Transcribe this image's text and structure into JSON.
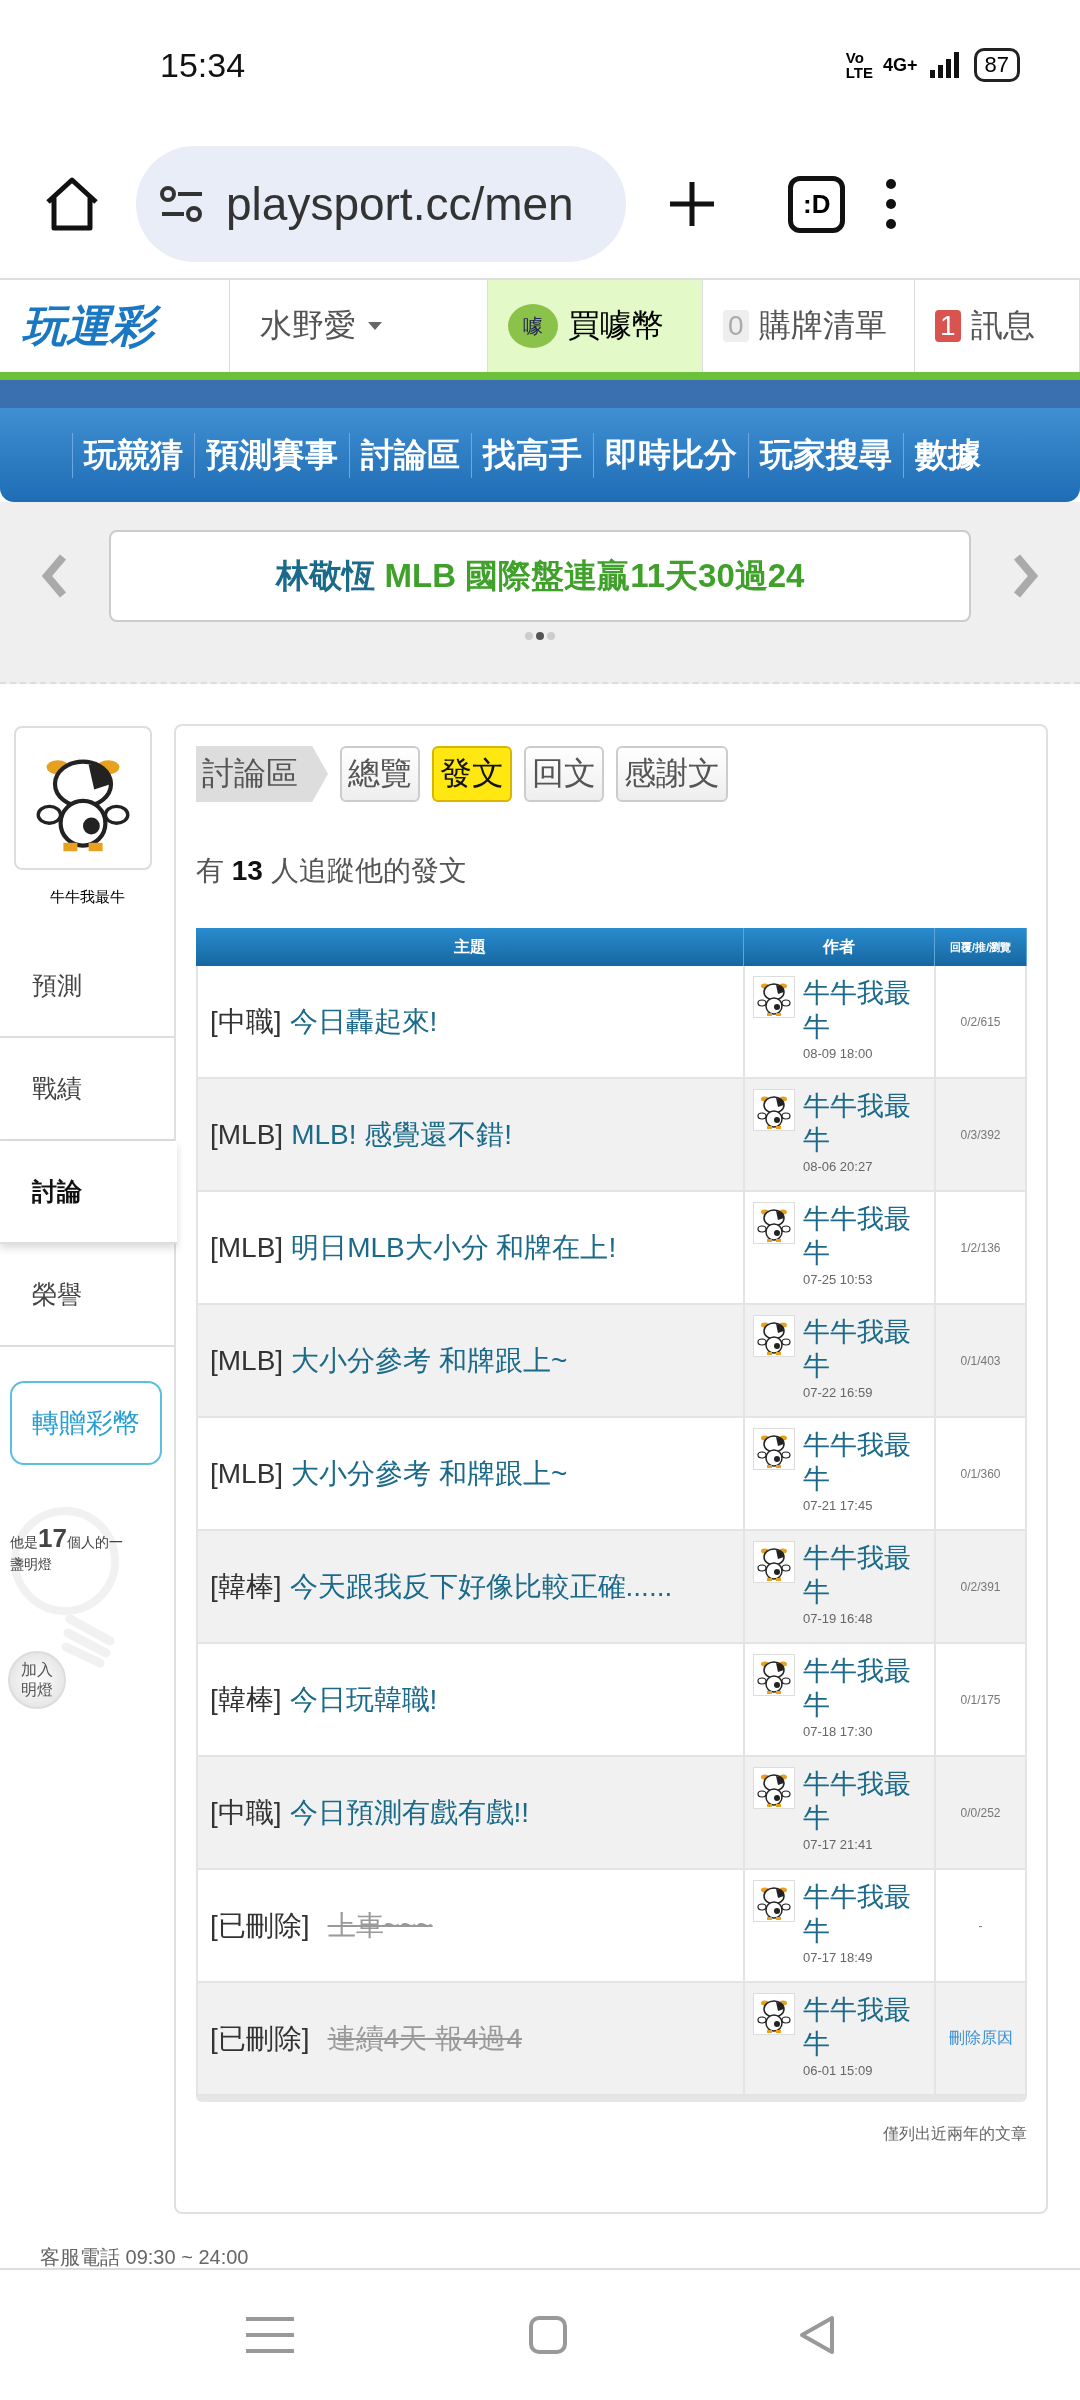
{
  "status_bar": {
    "time": "15:34",
    "volte": [
      "Vo",
      "LTE"
    ],
    "network": "4G+",
    "battery": "87"
  },
  "browser": {
    "url": "playsport.cc/men",
    "tabs_label": ":D"
  },
  "site_header": {
    "logo": "玩運彩",
    "user": "水野愛",
    "buy": {
      "coin_glyph": "噱",
      "label": "買噱幣"
    },
    "cart": {
      "count": "0",
      "label": "購牌清單"
    },
    "messages": {
      "count": "1",
      "label": "訊息"
    }
  },
  "nav": [
    "玩競猜",
    "預測賽事",
    "討論區",
    "找高手",
    "即時比分",
    "玩家搜尋",
    "數據"
  ],
  "banner": {
    "name": "林敬恆",
    "text": "MLB 國際盤連贏11天30過24",
    "dots": [
      {
        "selected": false
      },
      {
        "selected": true
      },
      {
        "selected": false
      }
    ]
  },
  "profile": {
    "name": "牛牛我最牛",
    "menu": [
      {
        "label": "預測",
        "selected": false
      },
      {
        "label": "戰績",
        "selected": false
      },
      {
        "label": "討論",
        "selected": true
      },
      {
        "label": "榮譽",
        "selected": false
      }
    ],
    "gift_button": "轉贈彩幣",
    "lamp_text": "他是**17**個人的一盞明燈",
    "lamp_button": "加入明燈"
  },
  "forum": {
    "section": "討論區",
    "tabs": [
      {
        "label": "總覽",
        "selected": false
      },
      {
        "label": "發文",
        "selected": true
      },
      {
        "label": "回文",
        "selected": false
      },
      {
        "label": "感謝文",
        "selected": false
      }
    ],
    "follow_text": "有 **13** 人追蹤他的發文",
    "table": {
      "columns": [
        "主題",
        "作者",
        "回覆/推/瀏覽"
      ],
      "rows": [
        {
          "kind": "post",
          "category": "[中職]",
          "title": "今日轟起來!",
          "author": "牛牛我最牛",
          "date": "08-09 18:00",
          "stats": {
            "kind": "text",
            "text": "0/2/615"
          }
        },
        {
          "kind": "post",
          "category": "[MLB]",
          "title": "MLB! 感覺還不錯!",
          "author": "牛牛我最牛",
          "date": "08-06 20:27",
          "stats": {
            "kind": "text",
            "text": "0/3/392"
          }
        },
        {
          "kind": "post",
          "category": "[MLB]",
          "title": "明日MLB大小分 和牌在上!",
          "author": "牛牛我最牛",
          "date": "07-25 10:53",
          "stats": {
            "kind": "text",
            "text": "1/2/136"
          }
        },
        {
          "kind": "post",
          "category": "[MLB]",
          "title": "大小分參考 和牌跟上~",
          "author": "牛牛我最牛",
          "date": "07-22 16:59",
          "stats": {
            "kind": "text",
            "text": "0/1/403"
          }
        },
        {
          "kind": "post",
          "category": "[MLB]",
          "title": "大小分參考 和牌跟上~",
          "author": "牛牛我最牛",
          "date": "07-21 17:45",
          "stats": {
            "kind": "text",
            "text": "0/1/360"
          }
        },
        {
          "kind": "post",
          "category": "[韓棒]",
          "title": "今天跟我反下好像比較正確......",
          "author": "牛牛我最牛",
          "date": "07-19 16:48",
          "stats": {
            "kind": "text",
            "text": "0/2/391"
          }
        },
        {
          "kind": "post",
          "category": "[韓棒]",
          "title": "今日玩韓職!",
          "author": "牛牛我最牛",
          "date": "07-18 17:30",
          "stats": {
            "kind": "text",
            "text": "0/1/175"
          }
        },
        {
          "kind": "post",
          "category": "[中職]",
          "title": "今日預測有戲有戲!!",
          "author": "牛牛我最牛",
          "date": "07-17 21:41",
          "stats": {
            "kind": "text",
            "text": "0/0/252"
          }
        },
        {
          "kind": "deleted",
          "category": "[已刪除]",
          "title": "上車~~~",
          "author": "牛牛我最牛",
          "date": "07-17 18:49",
          "stats": {
            "kind": "text",
            "text": "-"
          }
        },
        {
          "kind": "deleted",
          "category": "[已刪除]",
          "title": "連續4天 報4過4",
          "author": "牛牛我最牛",
          "date": "06-01 15:09",
          "stats": {
            "kind": "link",
            "text": "刪除原因"
          }
        }
      ]
    },
    "note": "僅列出近兩年的文章"
  },
  "footer": "客服電話 09:30 ~ 24:00"
}
